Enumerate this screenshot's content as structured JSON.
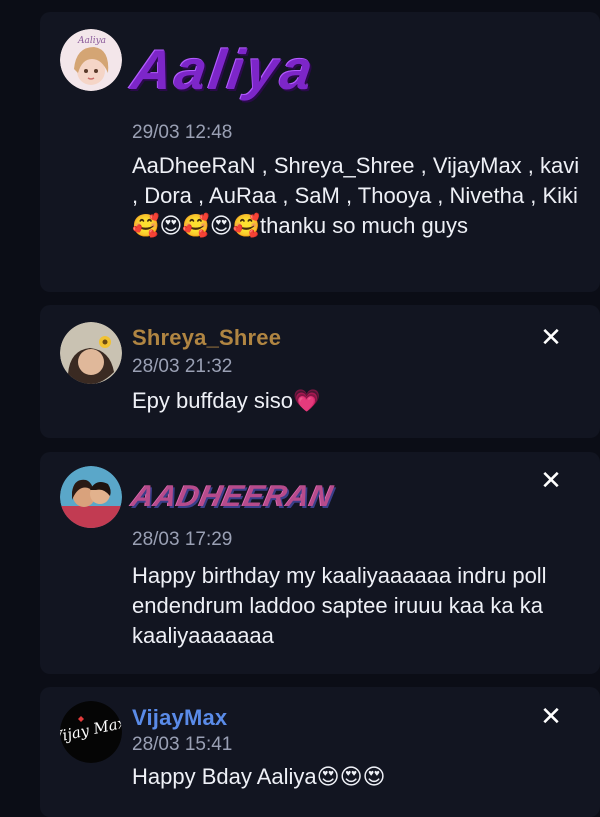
{
  "comments": [
    {
      "name": "Aaliya",
      "time": "29/03 12:48",
      "message": "AaDheeRaN , Shreya_Shree , VijayMax , kavi , Dora , AuRaa , SaM , Thooya , Nivetha , Kiki 🥰😍🥰😍🥰thanku so much guys",
      "avatar_icon": "aaliya-avatar-icon",
      "avatar_text": "Aaliya"
    },
    {
      "name": "Shreya_Shree",
      "time": "28/03 21:32",
      "message": "Epy buffday siso💗",
      "avatar_icon": "shreya-avatar-icon",
      "name_color": "#b08542"
    },
    {
      "name": "AADHEERAN",
      "time": "28/03 17:29",
      "message": "Happy birthday my kaaliyaaaaaa indru poll endendrum laddoo saptee iruuu kaa ka ka kaaliyaaaaaaa",
      "avatar_icon": "couple-avatar-icon"
    },
    {
      "name": "VijayMax",
      "time": "28/03 15:41",
      "message": "Happy Bday Aaliya😍😍😍",
      "avatar_icon": "vijaymax-avatar-icon",
      "avatar_text": "Vijay Max",
      "name_color": "#5a8be8"
    }
  ],
  "close_glyph": "✕",
  "colors": {
    "background": "#0b0d16",
    "card": "#121521",
    "timestamp": "#9aa0b4"
  }
}
